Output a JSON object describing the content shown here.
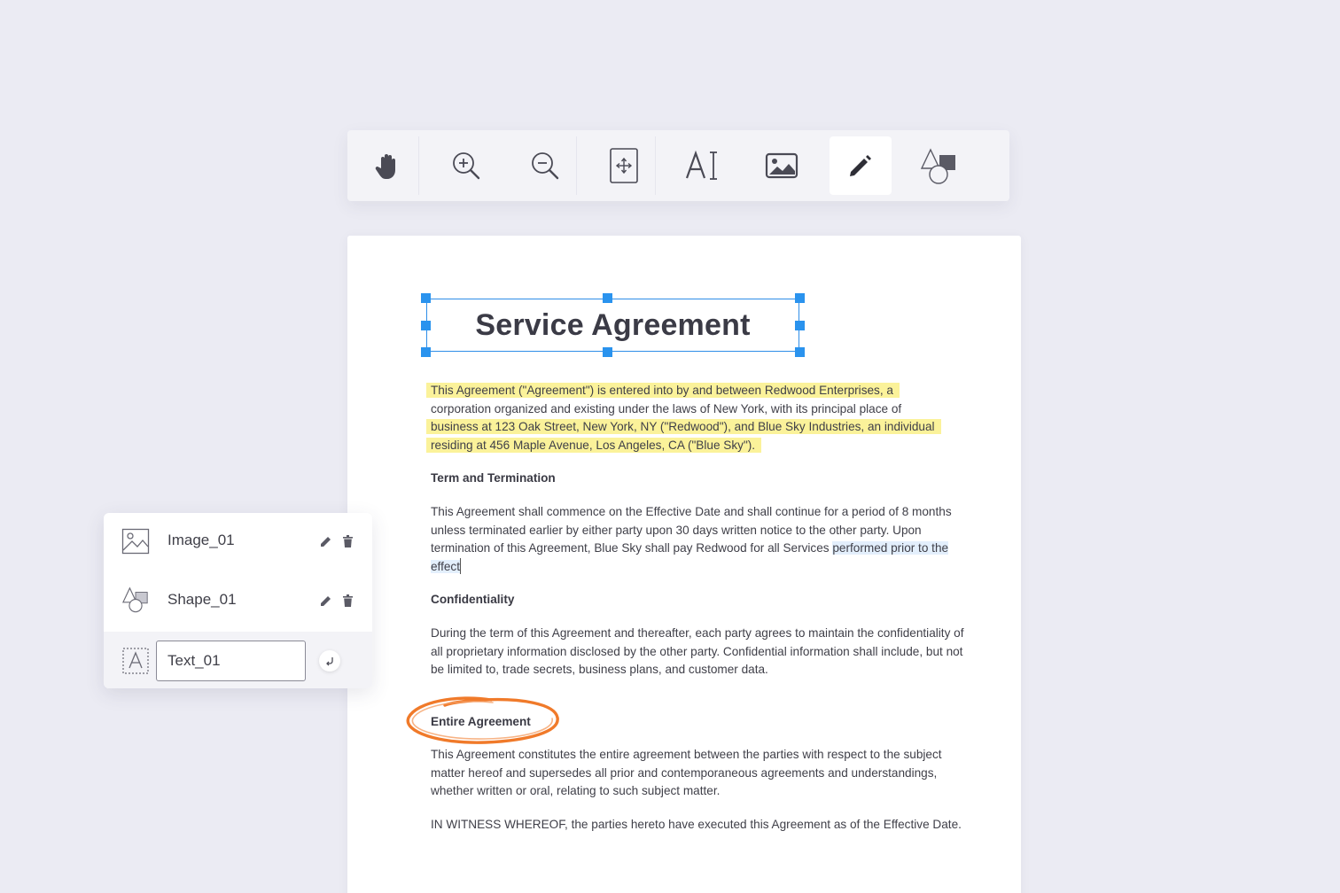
{
  "toolbar": {
    "tools": [
      {
        "name": "hand-tool",
        "icon": "hand-icon"
      },
      {
        "name": "zoom-in-tool",
        "icon": "zoom-in-icon"
      },
      {
        "name": "zoom-out-tool",
        "icon": "zoom-out-icon"
      },
      {
        "name": "move-page-tool",
        "icon": "move-page-icon"
      },
      {
        "name": "text-tool",
        "icon": "text-cursor-icon"
      },
      {
        "name": "image-tool",
        "icon": "image-icon"
      },
      {
        "name": "pencil-tool",
        "icon": "pencil-icon",
        "active": true
      },
      {
        "name": "shape-tool",
        "icon": "shapes-icon"
      }
    ]
  },
  "document": {
    "title": "Service Agreement",
    "intro": {
      "line1": "This Agreement (\"Agreement\") is entered into by and between Redwood Enterprises, a",
      "line2": "corporation organized and existing under the laws of New York, with its principal place of",
      "line3": "business at 123 Oak Street, New York, NY (\"Redwood\"), and Blue Sky Industries, an individual",
      "line4": "residing at 456 Maple Avenue, Los Angeles, CA (\"Blue Sky\")."
    },
    "sections": [
      {
        "heading": "Term and Termination",
        "text": "This Agreement shall commence on the Effective Date and shall continue for a period of 8 months unless terminated earlier by either party upon 30 days written notice to the other party. Upon termination of this Agreement, Blue Sky shall pay Redwood for all Services",
        "selected": "performed prior to the effect"
      },
      {
        "heading": "Confidentiality",
        "text": "During the term of this Agreement and thereafter, each party agrees to maintain the confidentiality of all proprietary information disclosed by the other party. Confidential information shall include, but not be limited to, trade secrets, business plans, and customer data."
      },
      {
        "heading": "Entire Agreement",
        "text": "This Agreement constitutes the entire agreement between the parties with respect to the subject matter hereof and supersedes all prior and contemporaneous agreements and understandings, whether written or oral, relating to such subject matter."
      }
    ],
    "closing": "IN WITNESS WHEREOF, the parties hereto have executed this Agreement as of the Effective Date."
  },
  "layers": [
    {
      "name": "Image_01",
      "icon": "image-layer-icon"
    },
    {
      "name": "Shape_01",
      "icon": "shape-layer-icon"
    },
    {
      "name": "Text_01",
      "icon": "text-layer-icon",
      "editing": true
    }
  ],
  "colors": {
    "selection": "#2a93ee",
    "highlight": "#fbf29a",
    "annotation_circle": "#f07a2a"
  }
}
